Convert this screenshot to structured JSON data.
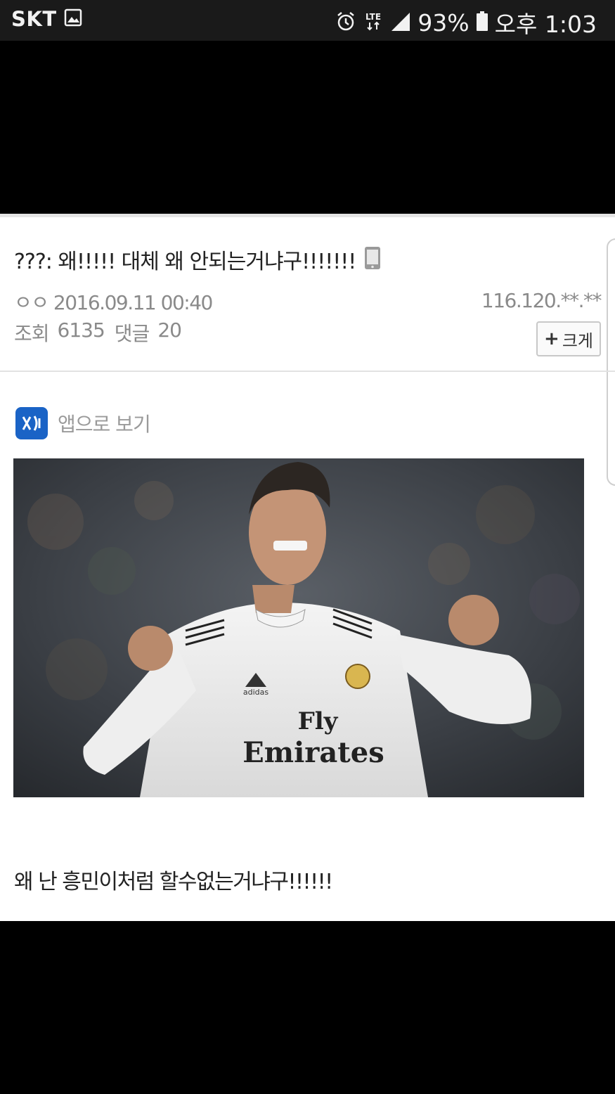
{
  "status_bar": {
    "carrier": "SKT",
    "network": "LTE",
    "battery": "93%",
    "time": "오후 1:03",
    "icons": [
      "gallery-icon",
      "alarm-icon",
      "lte-icon",
      "signal-icon",
      "battery-icon"
    ]
  },
  "post": {
    "title": "???: 왜!!!!! 대체 왜 안되는거냐구!!!!!!!",
    "author": "ㅇㅇ 2016.09.11 00:40",
    "ip": "116.120.**.**",
    "views_label": "조회",
    "views": "6135",
    "comments_label": "댓글",
    "comments": "20",
    "enlarge_label": "크게",
    "app_view_label": "앱으로 보기",
    "body": "왜 난 흥민이처럼 할수없는거냐구!!!!!!",
    "photo": {
      "jersey_sponsor_line1": "Fly",
      "jersey_sponsor_line2": "Emirates",
      "jersey_brand": "adidas"
    }
  },
  "colors": {
    "status_bar_bg": "#1a1a1a",
    "page_bg": "#000000",
    "card_bg": "#ffffff",
    "meta_text": "#8a8a8a",
    "app_logo": "#1a63c6"
  }
}
